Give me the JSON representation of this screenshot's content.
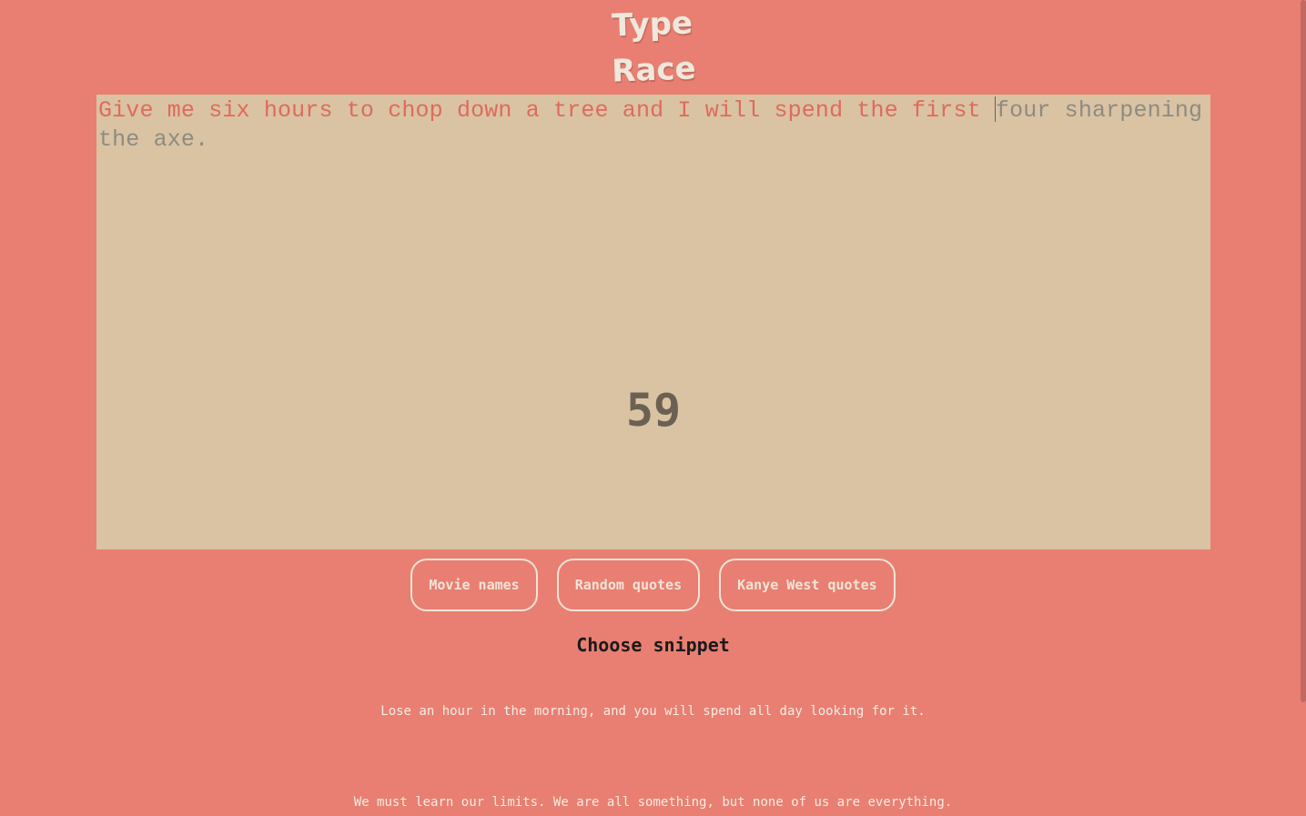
{
  "header": {
    "title_line1": "Type",
    "title_line2": "Race"
  },
  "game": {
    "typed_text": "Give me six hours to chop down a tree and I will spend the first ",
    "untyped_text": "four sharpening the axe.",
    "timer": "59"
  },
  "categories": [
    {
      "label": "Movie names"
    },
    {
      "label": "Random quotes"
    },
    {
      "label": "Kanye West quotes"
    }
  ],
  "choose_label": "Choose snippet",
  "snippets": [
    "Lose an hour in the morning, and you will spend all day looking for it.",
    "We must learn our limits. We are all something, but none of us are everything."
  ],
  "colors": {
    "background": "#e87f72",
    "panel": "#d9c3a3",
    "typed": "#e06a5c",
    "untyped": "#8e8b80",
    "timer": "#6b6153"
  }
}
